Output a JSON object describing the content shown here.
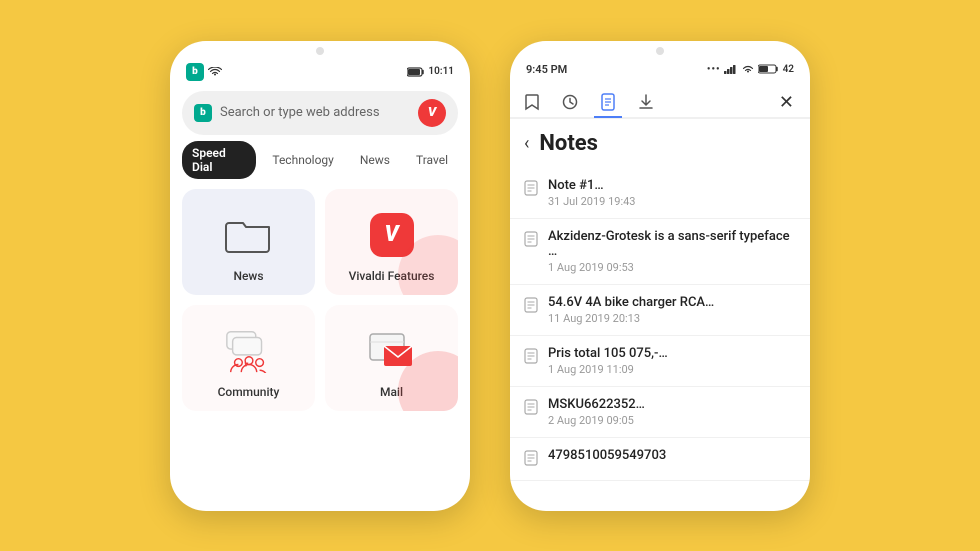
{
  "background_color": "#F5C842",
  "phone_left": {
    "status_bar": {
      "time": "10:11",
      "icons": [
        "signal",
        "wifi",
        "battery"
      ]
    },
    "search_placeholder": "Search or type web address",
    "tabs": [
      {
        "label": "Speed Dial",
        "active": true
      },
      {
        "label": "Technology",
        "active": false
      },
      {
        "label": "News",
        "active": false
      },
      {
        "label": "Travel",
        "active": false
      }
    ],
    "speed_dial_items": [
      {
        "label": "News",
        "type": "folder"
      },
      {
        "label": "Vivaldi Features",
        "type": "vivaldi"
      },
      {
        "label": "Community",
        "type": "community"
      },
      {
        "label": "Mail",
        "type": "mail"
      }
    ]
  },
  "phone_right": {
    "status_bar": {
      "time": "9:45 PM",
      "battery_label": "42"
    },
    "toolbar_icons": [
      {
        "name": "bookmark",
        "active": false
      },
      {
        "name": "history",
        "active": false
      },
      {
        "name": "notes",
        "active": true
      },
      {
        "name": "download",
        "active": false
      }
    ],
    "close_label": "✕",
    "back_label": "‹",
    "title": "Notes",
    "notes": [
      {
        "name": "Note #1…",
        "date": "31 Jul 2019 19:43"
      },
      {
        "name": "Akzidenz-Grotesk is a sans-serif typeface …",
        "date": "1 Aug 2019 09:53"
      },
      {
        "name": "54.6V 4A bike charger RCA…",
        "date": "11 Aug 2019 20:13"
      },
      {
        "name": "Pris total 105 075,-…",
        "date": "1 Aug 2019 11:09"
      },
      {
        "name": "MSKU6622352…",
        "date": "2 Aug 2019 09:05"
      },
      {
        "name": "4798510059549703",
        "date": ""
      }
    ]
  }
}
